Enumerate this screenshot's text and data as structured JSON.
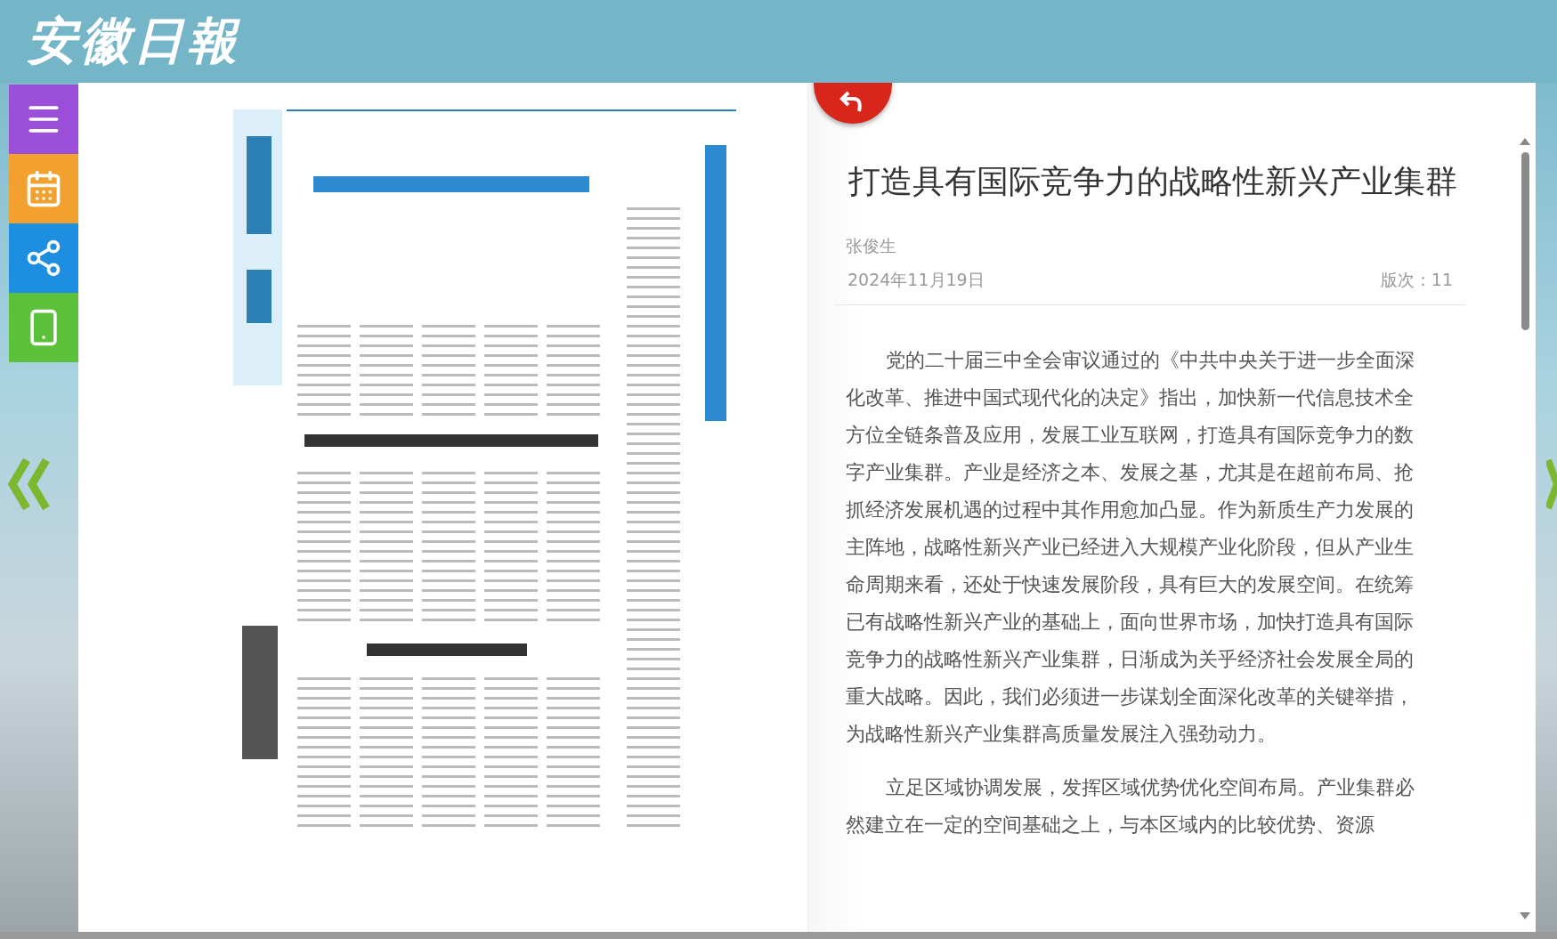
{
  "header": {
    "logo": "安徽日報"
  },
  "sidebar": {
    "buttons": [
      {
        "kind": "menu",
        "color": "#9b4fd8"
      },
      {
        "kind": "calendar",
        "color": "#f3a12e"
      },
      {
        "kind": "share",
        "color": "#1e8fe0"
      },
      {
        "kind": "mobile",
        "color": "#5cc13a"
      }
    ]
  },
  "article": {
    "title": "打造具有国际竞争力的战略性新兴产业集群",
    "author": "张俊生",
    "date": "2024年11月19日",
    "edition": "版次：11",
    "paragraphs": [
      "党的二十届三中全会审议通过的《中共中央关于进一步全面深化改革、推进中国式现代化的决定》指出，加快新一代信息技术全方位全链条普及应用，发展工业互联网，打造具有国际竞争力的数字产业集群。产业是经济之本、发展之基，尤其是在超前布局、抢抓经济发展机遇的过程中其作用愈加凸显。作为新质生产力发展的主阵地，战略性新兴产业已经进入大规模产业化阶段，但从产业生命周期来看，还处于快速发展阶段，具有巨大的发展空间。在统筹已有战略性新兴产业的基础上，面向世界市场，加快打造具有国际竞争力的战略性新兴产业集群，日渐成为关乎经济社会发展全局的重大战略。因此，我们必须进一步谋划全面深化改革的关键举措，为战略性新兴产业集群高质量发展注入强劲动力。",
      "立足区域协调发展，发挥区域优势优化空间布局。产业集群必然建立在一定的空间基础之上，与本区域内的比较优势、资源"
    ]
  }
}
